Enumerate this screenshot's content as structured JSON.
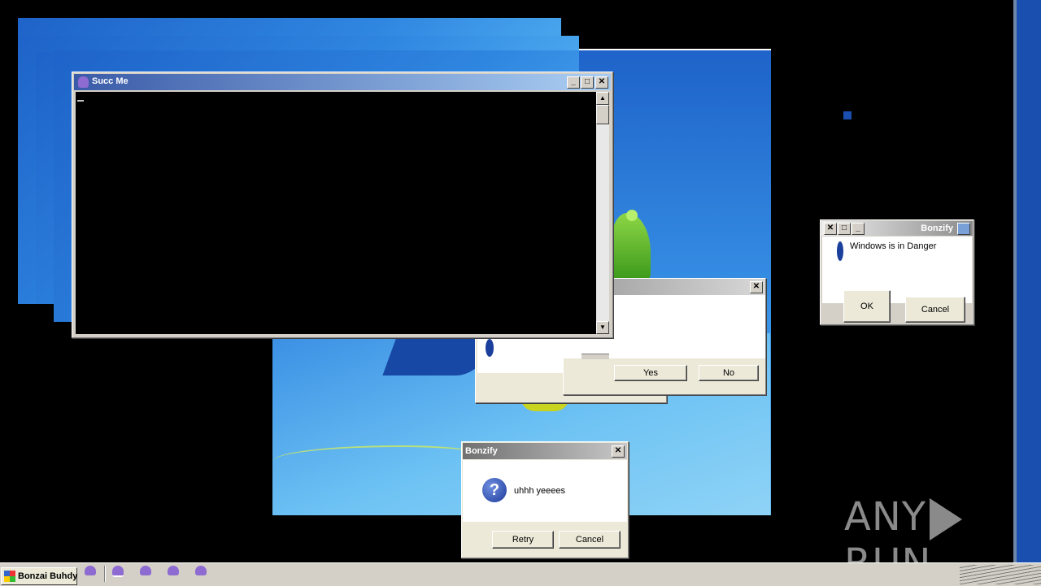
{
  "console_window": {
    "title": "Succ Me"
  },
  "yes_no_dialog": {
    "yes_label": "Yes",
    "no_label": "No"
  },
  "danger_dialog": {
    "title": "Bonzify",
    "message": "Windows is in Danger",
    "ok_label": "OK",
    "cancel_label": "Cancel"
  },
  "question_dialog": {
    "title": "Bonzify",
    "message": "uhhh yeeees",
    "retry_label": "Retry",
    "cancel_label": "Cancel"
  },
  "taskbar": {
    "task_label": "Bonzai Buhdy",
    "tray_icons": [
      "bonzi-icon",
      "bonzi-icon",
      "bonzi-icon",
      "bonzi-icon",
      "bonzi-icon"
    ]
  },
  "watermark": {
    "left_text": "ANY",
    "right_text": "RUN"
  }
}
